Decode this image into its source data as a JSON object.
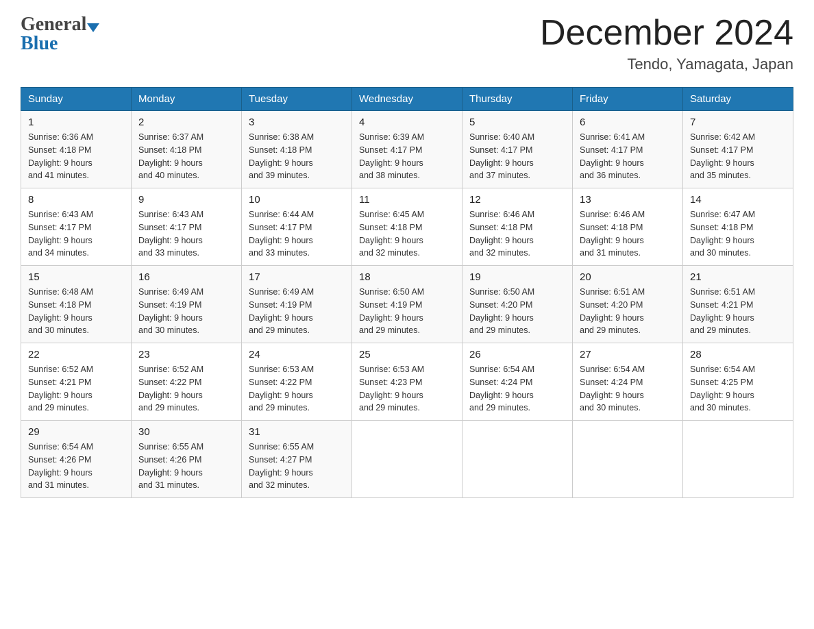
{
  "logo": {
    "general": "General",
    "blue": "Blue",
    "line2_blue": "Blue"
  },
  "title": "December 2024",
  "subtitle": "Tendo, Yamagata, Japan",
  "days_header": [
    "Sunday",
    "Monday",
    "Tuesday",
    "Wednesday",
    "Thursday",
    "Friday",
    "Saturday"
  ],
  "weeks": [
    [
      {
        "num": "1",
        "sunrise": "Sunrise: 6:36 AM",
        "sunset": "Sunset: 4:18 PM",
        "daylight": "Daylight: 9 hours",
        "daylight2": "and 41 minutes."
      },
      {
        "num": "2",
        "sunrise": "Sunrise: 6:37 AM",
        "sunset": "Sunset: 4:18 PM",
        "daylight": "Daylight: 9 hours",
        "daylight2": "and 40 minutes."
      },
      {
        "num": "3",
        "sunrise": "Sunrise: 6:38 AM",
        "sunset": "Sunset: 4:18 PM",
        "daylight": "Daylight: 9 hours",
        "daylight2": "and 39 minutes."
      },
      {
        "num": "4",
        "sunrise": "Sunrise: 6:39 AM",
        "sunset": "Sunset: 4:17 PM",
        "daylight": "Daylight: 9 hours",
        "daylight2": "and 38 minutes."
      },
      {
        "num": "5",
        "sunrise": "Sunrise: 6:40 AM",
        "sunset": "Sunset: 4:17 PM",
        "daylight": "Daylight: 9 hours",
        "daylight2": "and 37 minutes."
      },
      {
        "num": "6",
        "sunrise": "Sunrise: 6:41 AM",
        "sunset": "Sunset: 4:17 PM",
        "daylight": "Daylight: 9 hours",
        "daylight2": "and 36 minutes."
      },
      {
        "num": "7",
        "sunrise": "Sunrise: 6:42 AM",
        "sunset": "Sunset: 4:17 PM",
        "daylight": "Daylight: 9 hours",
        "daylight2": "and 35 minutes."
      }
    ],
    [
      {
        "num": "8",
        "sunrise": "Sunrise: 6:43 AM",
        "sunset": "Sunset: 4:17 PM",
        "daylight": "Daylight: 9 hours",
        "daylight2": "and 34 minutes."
      },
      {
        "num": "9",
        "sunrise": "Sunrise: 6:43 AM",
        "sunset": "Sunset: 4:17 PM",
        "daylight": "Daylight: 9 hours",
        "daylight2": "and 33 minutes."
      },
      {
        "num": "10",
        "sunrise": "Sunrise: 6:44 AM",
        "sunset": "Sunset: 4:17 PM",
        "daylight": "Daylight: 9 hours",
        "daylight2": "and 33 minutes."
      },
      {
        "num": "11",
        "sunrise": "Sunrise: 6:45 AM",
        "sunset": "Sunset: 4:18 PM",
        "daylight": "Daylight: 9 hours",
        "daylight2": "and 32 minutes."
      },
      {
        "num": "12",
        "sunrise": "Sunrise: 6:46 AM",
        "sunset": "Sunset: 4:18 PM",
        "daylight": "Daylight: 9 hours",
        "daylight2": "and 32 minutes."
      },
      {
        "num": "13",
        "sunrise": "Sunrise: 6:46 AM",
        "sunset": "Sunset: 4:18 PM",
        "daylight": "Daylight: 9 hours",
        "daylight2": "and 31 minutes."
      },
      {
        "num": "14",
        "sunrise": "Sunrise: 6:47 AM",
        "sunset": "Sunset: 4:18 PM",
        "daylight": "Daylight: 9 hours",
        "daylight2": "and 30 minutes."
      }
    ],
    [
      {
        "num": "15",
        "sunrise": "Sunrise: 6:48 AM",
        "sunset": "Sunset: 4:18 PM",
        "daylight": "Daylight: 9 hours",
        "daylight2": "and 30 minutes."
      },
      {
        "num": "16",
        "sunrise": "Sunrise: 6:49 AM",
        "sunset": "Sunset: 4:19 PM",
        "daylight": "Daylight: 9 hours",
        "daylight2": "and 30 minutes."
      },
      {
        "num": "17",
        "sunrise": "Sunrise: 6:49 AM",
        "sunset": "Sunset: 4:19 PM",
        "daylight": "Daylight: 9 hours",
        "daylight2": "and 29 minutes."
      },
      {
        "num": "18",
        "sunrise": "Sunrise: 6:50 AM",
        "sunset": "Sunset: 4:19 PM",
        "daylight": "Daylight: 9 hours",
        "daylight2": "and 29 minutes."
      },
      {
        "num": "19",
        "sunrise": "Sunrise: 6:50 AM",
        "sunset": "Sunset: 4:20 PM",
        "daylight": "Daylight: 9 hours",
        "daylight2": "and 29 minutes."
      },
      {
        "num": "20",
        "sunrise": "Sunrise: 6:51 AM",
        "sunset": "Sunset: 4:20 PM",
        "daylight": "Daylight: 9 hours",
        "daylight2": "and 29 minutes."
      },
      {
        "num": "21",
        "sunrise": "Sunrise: 6:51 AM",
        "sunset": "Sunset: 4:21 PM",
        "daylight": "Daylight: 9 hours",
        "daylight2": "and 29 minutes."
      }
    ],
    [
      {
        "num": "22",
        "sunrise": "Sunrise: 6:52 AM",
        "sunset": "Sunset: 4:21 PM",
        "daylight": "Daylight: 9 hours",
        "daylight2": "and 29 minutes."
      },
      {
        "num": "23",
        "sunrise": "Sunrise: 6:52 AM",
        "sunset": "Sunset: 4:22 PM",
        "daylight": "Daylight: 9 hours",
        "daylight2": "and 29 minutes."
      },
      {
        "num": "24",
        "sunrise": "Sunrise: 6:53 AM",
        "sunset": "Sunset: 4:22 PM",
        "daylight": "Daylight: 9 hours",
        "daylight2": "and 29 minutes."
      },
      {
        "num": "25",
        "sunrise": "Sunrise: 6:53 AM",
        "sunset": "Sunset: 4:23 PM",
        "daylight": "Daylight: 9 hours",
        "daylight2": "and 29 minutes."
      },
      {
        "num": "26",
        "sunrise": "Sunrise: 6:54 AM",
        "sunset": "Sunset: 4:24 PM",
        "daylight": "Daylight: 9 hours",
        "daylight2": "and 29 minutes."
      },
      {
        "num": "27",
        "sunrise": "Sunrise: 6:54 AM",
        "sunset": "Sunset: 4:24 PM",
        "daylight": "Daylight: 9 hours",
        "daylight2": "and 30 minutes."
      },
      {
        "num": "28",
        "sunrise": "Sunrise: 6:54 AM",
        "sunset": "Sunset: 4:25 PM",
        "daylight": "Daylight: 9 hours",
        "daylight2": "and 30 minutes."
      }
    ],
    [
      {
        "num": "29",
        "sunrise": "Sunrise: 6:54 AM",
        "sunset": "Sunset: 4:26 PM",
        "daylight": "Daylight: 9 hours",
        "daylight2": "and 31 minutes."
      },
      {
        "num": "30",
        "sunrise": "Sunrise: 6:55 AM",
        "sunset": "Sunset: 4:26 PM",
        "daylight": "Daylight: 9 hours",
        "daylight2": "and 31 minutes."
      },
      {
        "num": "31",
        "sunrise": "Sunrise: 6:55 AM",
        "sunset": "Sunset: 4:27 PM",
        "daylight": "Daylight: 9 hours",
        "daylight2": "and 32 minutes."
      },
      null,
      null,
      null,
      null
    ]
  ]
}
